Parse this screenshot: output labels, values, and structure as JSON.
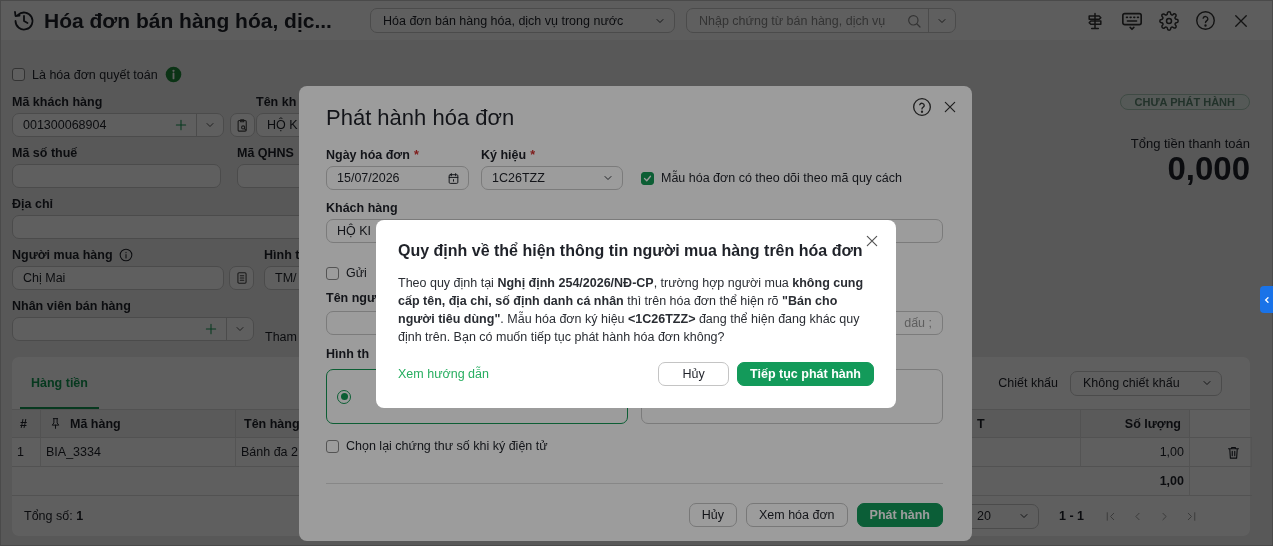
{
  "header": {
    "title": "Hóa đơn bán hàng hóa, dịc...",
    "invoice_type": "Hóa đơn bán hàng hóa, dịch vụ trong nước",
    "search": {
      "placeholder": "Nhập chứng từ bán hàng, dịch vụ"
    }
  },
  "form": {
    "settlement": {
      "label": "Là hóa đơn quyết toán",
      "checked": false
    },
    "customer_code": {
      "label": "Mã khách hàng",
      "value": "001300068904"
    },
    "customer_name": {
      "label": "Tên kh",
      "value": "HỘ K"
    },
    "tax_code": {
      "label": "Mã số thuế"
    },
    "budget_code": {
      "label": "Mã QHNS"
    },
    "address": {
      "label": "Địa chỉ"
    },
    "buyer": {
      "label": "Người mua hàng",
      "value": "Chị Mai"
    },
    "payment_method": {
      "label": "Hình t",
      "value": "TM/"
    },
    "salesperson": {
      "label": "Nhân viên bán hàng"
    },
    "reference": {
      "label": "Tham"
    }
  },
  "summary": {
    "status": "CHƯA PHÁT HÀNH",
    "total_label": "Tổng tiền thanh toán",
    "total": "0,000"
  },
  "items": {
    "tabs": [
      {
        "label": "Hàng tiền",
        "selected": true
      }
    ],
    "discount": {
      "label": "Chiết khấu",
      "value": "Không chiết khấu"
    },
    "columns": [
      "#",
      "Mã hàng",
      "Tên hàng",
      "T",
      "Số lượng"
    ],
    "rows": [
      {
        "index": "1",
        "code": "BIA_3334",
        "name": "Bánh đa 2",
        "quantity": "1,00"
      }
    ],
    "total_quantity": "1,00",
    "count": "Tổng số: **1**",
    "page_size": "20",
    "range": "1 - 1"
  },
  "issue_dialog": {
    "title": "Phát hành hóa đơn",
    "date": {
      "label": "Ngày hóa đơn",
      "required_mark": "*",
      "value": "15/07/2026"
    },
    "symbol": {
      "label": "Ký hiệu",
      "required_mark": "*",
      "value": "1C26TZZ"
    },
    "track_spec": {
      "label": "Mẫu hóa đơn có theo dõi theo mã quy cách",
      "checked": true
    },
    "customer": {
      "label": "Khách hàng",
      "value": "HỘ KI"
    },
    "send": {
      "label": "Gửi",
      "checked": false
    },
    "recipient": {
      "label": "Tên ngư",
      "placeholder": "dấu ;"
    },
    "method": {
      "label": "Hình th",
      "options": [
        {
          "selected": true
        },
        {
          "selected": false
        }
      ]
    },
    "reselect_cert": {
      "label": "Chọn lại chứng thư số khi ký điện tử",
      "checked": false
    },
    "buttons": [
      {
        "label": "Hủy",
        "kind": "secondary"
      },
      {
        "label": "Xem hóa đơn",
        "kind": "secondary"
      },
      {
        "label": "Phát hành",
        "kind": "primary"
      }
    ]
  },
  "confirm_dialog": {
    "title": "Quy định về thể hiện thông tin người mua hàng trên hóa đơn",
    "message": "Theo quy định tại **Nghị định 254/2026/NĐ-CP**, trường hợp người mua **không cung cấp tên, địa chỉ, số định danh cá nhân** thì trên hóa đơn thể hiện rõ **\"Bán cho người tiêu dùng\"**. Mẫu hóa đơn ký hiệu **<1C26TZZ>** đang thể hiện đang khác quy định trên. Bạn có muốn tiếp tục phát hành hóa đơn không?",
    "guide_link": "Xem hướng dẫn",
    "buttons": [
      {
        "label": "Hủy",
        "kind": "secondary"
      },
      {
        "label": "Tiếp tục phát hành",
        "kind": "primary"
      }
    ]
  }
}
